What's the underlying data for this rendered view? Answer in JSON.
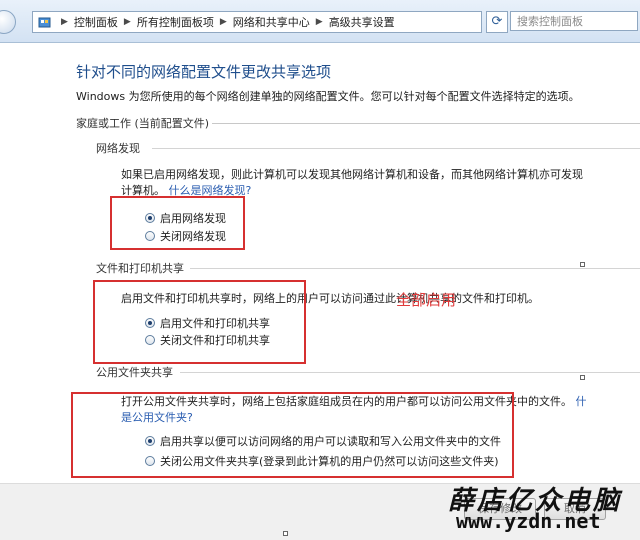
{
  "breadcrumb": [
    "控制面板",
    "所有控制面板项",
    "网络和共享中心",
    "高级共享设置"
  ],
  "search_placeholder": "搜索控制面板",
  "page_title": "针对不同的网络配置文件更改共享选项",
  "intro": "Windows 为您所使用的每个网络创建单独的网络配置文件。您可以针对每个配置文件选择特定的选项。",
  "group_title": "家庭或工作 (当前配置文件)",
  "discovery": {
    "title": "网络发现",
    "desc_line1": "如果已启用网络发现，则此计算机可以发现其他网络计算机和设备，而其他网络计算机亦可发现",
    "desc_line2_prefix": "计算机。",
    "link": "什么是网络发现?",
    "options": [
      {
        "label": "启用网络发现",
        "checked": true
      },
      {
        "label": "关闭网络发现",
        "checked": false
      }
    ]
  },
  "file_sharing": {
    "title": "文件和打印机共享",
    "desc": "启用文件和打印机共享时，网络上的用户可以访问通过此计算机共享的文件和打印机。",
    "options": [
      {
        "label": "启用文件和打印机共享",
        "checked": true
      },
      {
        "label": "关闭文件和打印机共享",
        "checked": false
      }
    ]
  },
  "public_folder": {
    "title": "公用文件夹共享",
    "desc_line1": "打开公用文件夹共享时，网络上包括家庭组成员在内的用户都可以访问公用文件夹中的文件。",
    "link_part1": "什",
    "link_part2": "是公用文件夹?",
    "options": [
      {
        "label": "启用共享以便可以访问网络的用户可以读取和写入公用文件夹中的文件",
        "checked": true
      },
      {
        "label": "关闭公用文件夹共享(登录到此计算机的用户仍然可以访问这些文件夹)",
        "checked": false
      }
    ]
  },
  "annotation": "全部启用",
  "buttons": {
    "save": "保存修改",
    "cancel": "取消"
  },
  "watermark": {
    "name": "薛店亿众电脑",
    "url": "www.yzdn.net"
  },
  "colors": {
    "title_blue": "#1f4e8c",
    "link_blue": "#2a5db0",
    "annotation_red": "#d63030"
  }
}
